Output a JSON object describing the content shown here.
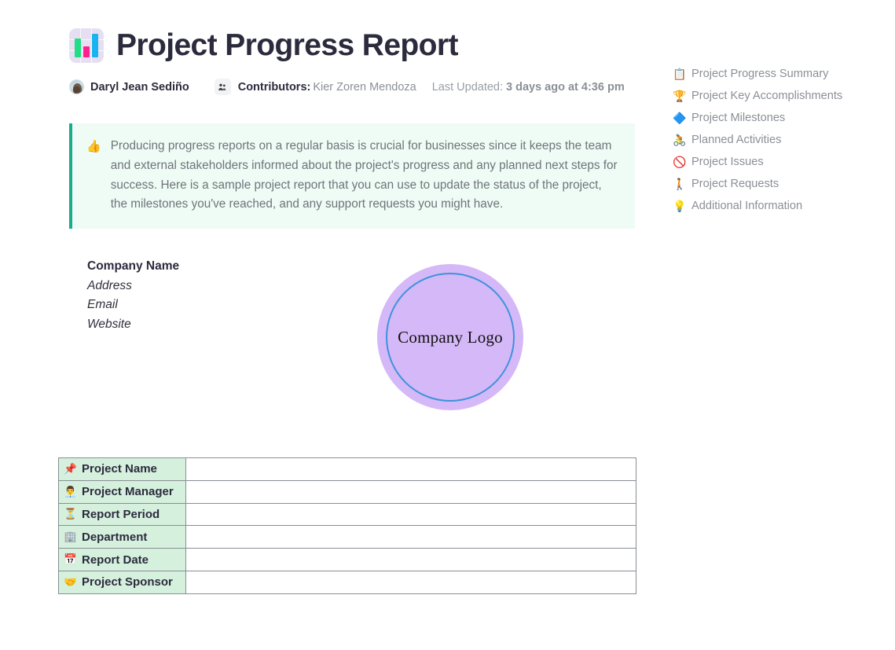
{
  "header": {
    "title": "Project Progress Report",
    "title_icon": "bar-chart-icon",
    "author": "Daryl Jean Sediño",
    "author_avatar": "user-avatar",
    "contributors_icon": "people-icon",
    "contributors_label": "Contributors:",
    "contributors_names": "Kier Zoren Mendoza",
    "updated_label": "Last Updated:",
    "updated_value": "3 days ago at 4:36 pm"
  },
  "callout": {
    "icon": "👍",
    "icon_name": "thumbs-up-icon",
    "text": "Producing progress reports on a regular basis is crucial for businesses since it keeps the team and external stakeholders informed about the project's progress and any planned next steps for success. Here is a sample project report that you can use to update the status of the project, the milestones you've reached, and any support requests you might have."
  },
  "toc": {
    "items": [
      {
        "icon": "📋",
        "icon_name": "clipboard-icon",
        "label": "Project Progress Summary"
      },
      {
        "icon": "🏆",
        "icon_name": "trophy-icon",
        "label": "Project Key Accomplishments"
      },
      {
        "icon": "🔷",
        "icon_name": "blue-diamond-icon",
        "label": "Project Milestones"
      },
      {
        "icon": "🚴",
        "icon_name": "cyclist-icon",
        "label": "Planned Activities"
      },
      {
        "icon": "🚫",
        "icon_name": "prohibited-icon",
        "label": "Project Issues"
      },
      {
        "icon": "🚶",
        "icon_name": "person-walking-icon",
        "label": "Project Requests"
      },
      {
        "icon": "💡",
        "icon_name": "light-bulb-icon",
        "label": "Additional Information"
      }
    ]
  },
  "company": {
    "name": "Company Name",
    "address": "Address",
    "email": "Email",
    "website": "Website"
  },
  "logo": {
    "text": "Company Logo",
    "fill_color": "#d5b8f7",
    "ring_color": "#3c93dd"
  },
  "info_table": {
    "rows": [
      {
        "icon": "📌",
        "icon_name": "pushpin-icon",
        "label": "Project Name",
        "value": ""
      },
      {
        "icon": "👨‍💼",
        "icon_name": "office-worker-icon",
        "label": "Project Manager",
        "value": ""
      },
      {
        "icon": "⏳",
        "icon_name": "hourglass-icon",
        "label": "Report Period",
        "value": ""
      },
      {
        "icon": "🏢",
        "icon_name": "office-building-icon",
        "label": "Department",
        "value": ""
      },
      {
        "icon": "📅",
        "icon_name": "calendar-icon",
        "label": "Report Date",
        "value": ""
      },
      {
        "icon": "🤝",
        "icon_name": "handshake-icon",
        "label": "Project Sponsor",
        "value": ""
      }
    ]
  },
  "colors": {
    "callout_bg": "#effcf5",
    "callout_border": "#18ae8d",
    "table_label_bg": "#d6f0de",
    "table_border": "#888e94",
    "title_text": "#2b2b3d",
    "muted_text": "#8b8f96"
  }
}
